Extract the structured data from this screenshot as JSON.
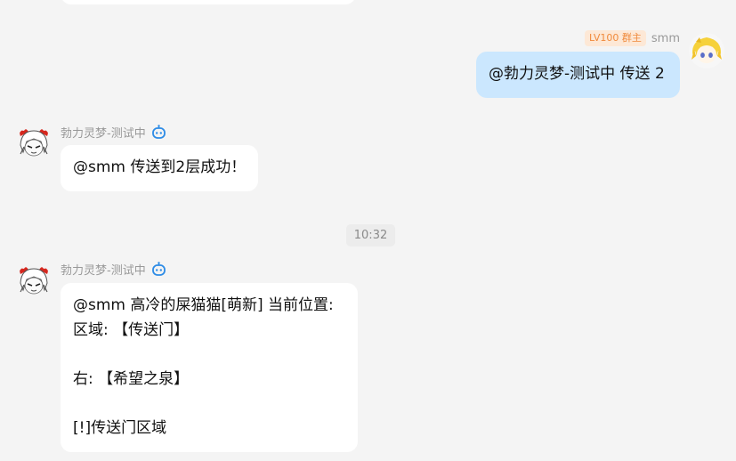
{
  "messages": [
    {
      "sender_name": "smm",
      "badge": "LV100 群主",
      "text": "@勃力灵梦-测试中 传送 2",
      "avatar_icon": "blonde-anime-avatar-icon"
    },
    {
      "sender_name": "勃力灵梦-测试中",
      "bot_icon": "robot-icon",
      "text": "@smm 传送到2层成功！",
      "avatar_icon": "reimu-avatar-icon"
    },
    {
      "sender_name": "勃力灵梦-测试中",
      "bot_icon": "robot-icon",
      "lines": [
        "@smm 高冷的屎猫猫[萌新] 当前位置:",
        "区域: 【传送门】",
        "",
        "右: 【希望之泉】",
        "",
        "[!]传送门区域"
      ],
      "avatar_icon": "reimu-avatar-icon"
    }
  ],
  "timestamp": "10:32",
  "colors": {
    "background": "#f4f4f4",
    "self_bubble": "#cbe7fe",
    "other_bubble": "#ffffff",
    "badge_text": "#f08a3c",
    "badge_bg": "#fde8d6",
    "bot_icon": "#2e8ce6"
  }
}
